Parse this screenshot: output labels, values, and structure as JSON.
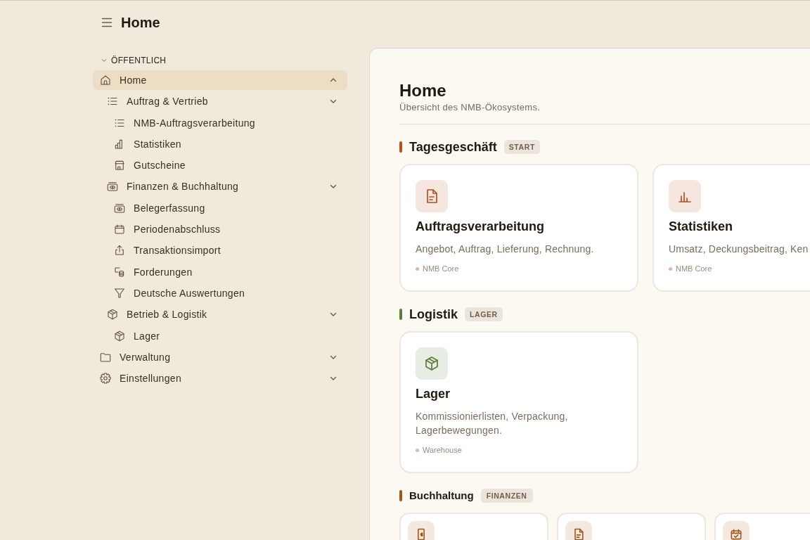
{
  "header": {
    "title": "Home"
  },
  "sidebar": {
    "section": {
      "label": "ÖFFENTLICH",
      "expanded": true
    },
    "items": [
      {
        "label": "Home",
        "kind": "home",
        "selected": true,
        "expanded": true,
        "children": [
          {
            "label": "Auftrag & Vertrieb",
            "kind": "list",
            "selected": false,
            "expanded": false,
            "children": [
              {
                "label": "NMB-Auftragsverarbeitung",
                "kind": "list",
                "selected": false
              },
              {
                "label": "Statistiken",
                "kind": "bars",
                "selected": false
              },
              {
                "label": "Gutscheine",
                "kind": "store",
                "selected": false
              }
            ]
          },
          {
            "label": "Finanzen & Buchhaltung",
            "kind": "cash",
            "selected": false,
            "expanded": false,
            "children": [
              {
                "label": "Belegerfassung",
                "kind": "cash",
                "selected": false
              },
              {
                "label": "Periodenabschluss",
                "kind": "calendar",
                "selected": false
              },
              {
                "label": "Transaktionsimport",
                "kind": "upload",
                "selected": false
              },
              {
                "label": "Forderungen",
                "kind": "coins",
                "selected": false
              },
              {
                "label": "Deutsche Auswertungen",
                "kind": "filter",
                "selected": false
              }
            ]
          },
          {
            "label": "Betrieb & Logistik",
            "kind": "box",
            "selected": false,
            "expanded": false,
            "children": [
              {
                "label": "Lager",
                "kind": "box",
                "selected": false
              }
            ]
          }
        ]
      },
      {
        "label": "Verwaltung",
        "kind": "folder",
        "selected": false,
        "expanded": false
      },
      {
        "label": "Einstellungen",
        "kind": "gear",
        "selected": false,
        "expanded": false
      }
    ]
  },
  "page": {
    "title": "Home",
    "subtitle": "Übersicht des NMB-Ökosystems."
  },
  "sections": [
    {
      "title": "Tagesgeschäft",
      "badge": "START",
      "kind": "large",
      "color": "#b5501f",
      "cards": [
        {
          "kind": "document",
          "title": "Auftragsverarbeitung",
          "description": "Angebot, Auftrag, Lieferung, Rechnung.",
          "tag": "NMB Core"
        },
        {
          "kind": "chart",
          "title": "Statistiken",
          "description": "Umsatz, Deckungsbeitrag, Ken",
          "tag": "NMB Core"
        }
      ]
    },
    {
      "title": "Logistik",
      "badge": "LAGER",
      "kind": "large",
      "color": "#5b7d3a",
      "cards": [
        {
          "kind": "box",
          "title": "Lager",
          "description": "Kommissionierlisten, Verpackung, Lagerbewegungen.",
          "tag": "Warehouse"
        }
      ]
    },
    {
      "title": "Buchhaltung",
      "badge": "FINANZEN",
      "kind": "compact",
      "color": "#a3561a",
      "cards": [
        {
          "kind": "door"
        },
        {
          "kind": "document"
        },
        {
          "kind": "calendar-check"
        }
      ]
    }
  ]
}
